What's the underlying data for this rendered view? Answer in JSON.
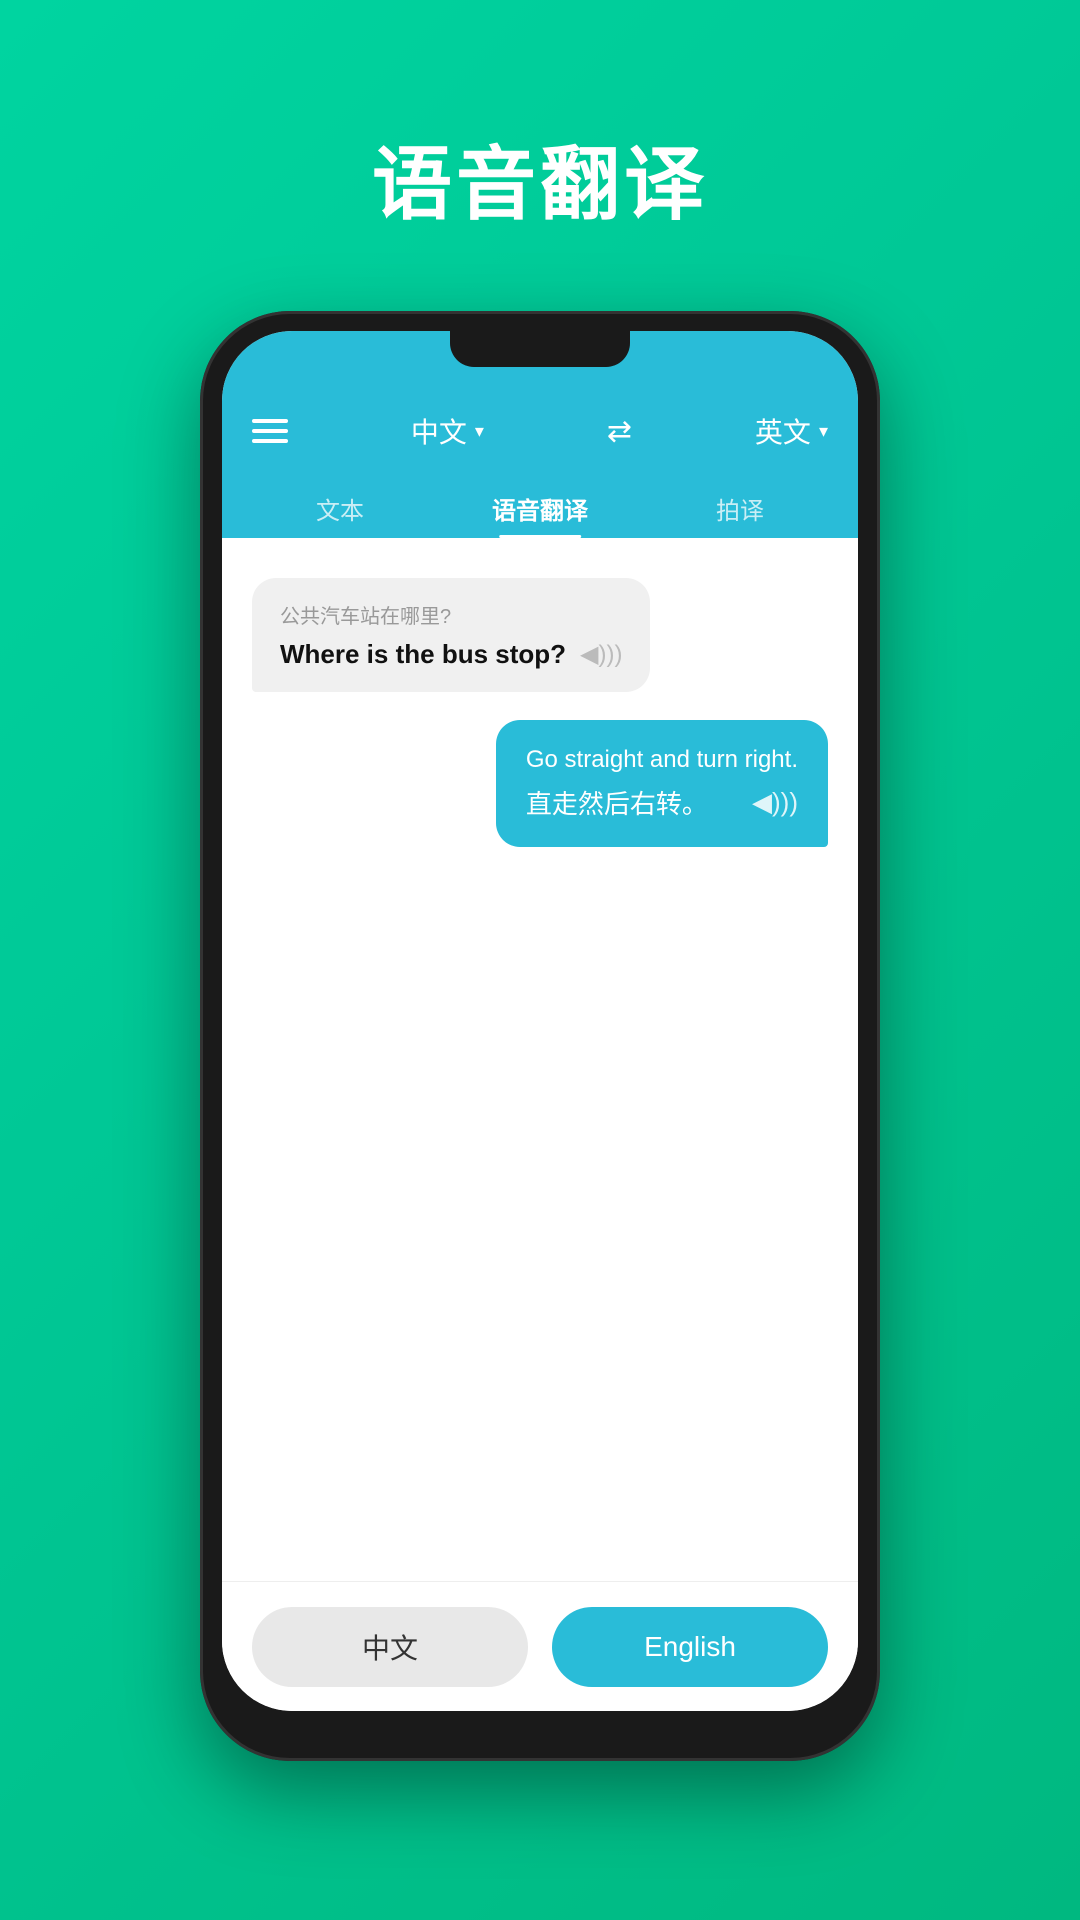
{
  "page": {
    "title": "语音翻译",
    "background_gradient_start": "#00d4a0",
    "background_gradient_end": "#00b880"
  },
  "header": {
    "source_lang": "中文",
    "source_lang_arrow": "▾",
    "target_lang": "英文",
    "target_lang_arrow": "▾",
    "swap_icon": "⇄"
  },
  "tabs": [
    {
      "label": "文本",
      "active": false
    },
    {
      "label": "语音翻译",
      "active": true
    },
    {
      "label": "拍译",
      "active": false
    }
  ],
  "messages": [
    {
      "side": "left",
      "subtitle": "公共汽车站在哪里?",
      "main_text": "Where is the bus stop?",
      "speaker": "◀)))"
    },
    {
      "side": "right",
      "line1": "Go straight and turn right.",
      "line2": "直走然后右转。",
      "speaker": "◀)))"
    }
  ],
  "bottom": {
    "chinese_label": "中文",
    "english_label": "English"
  }
}
